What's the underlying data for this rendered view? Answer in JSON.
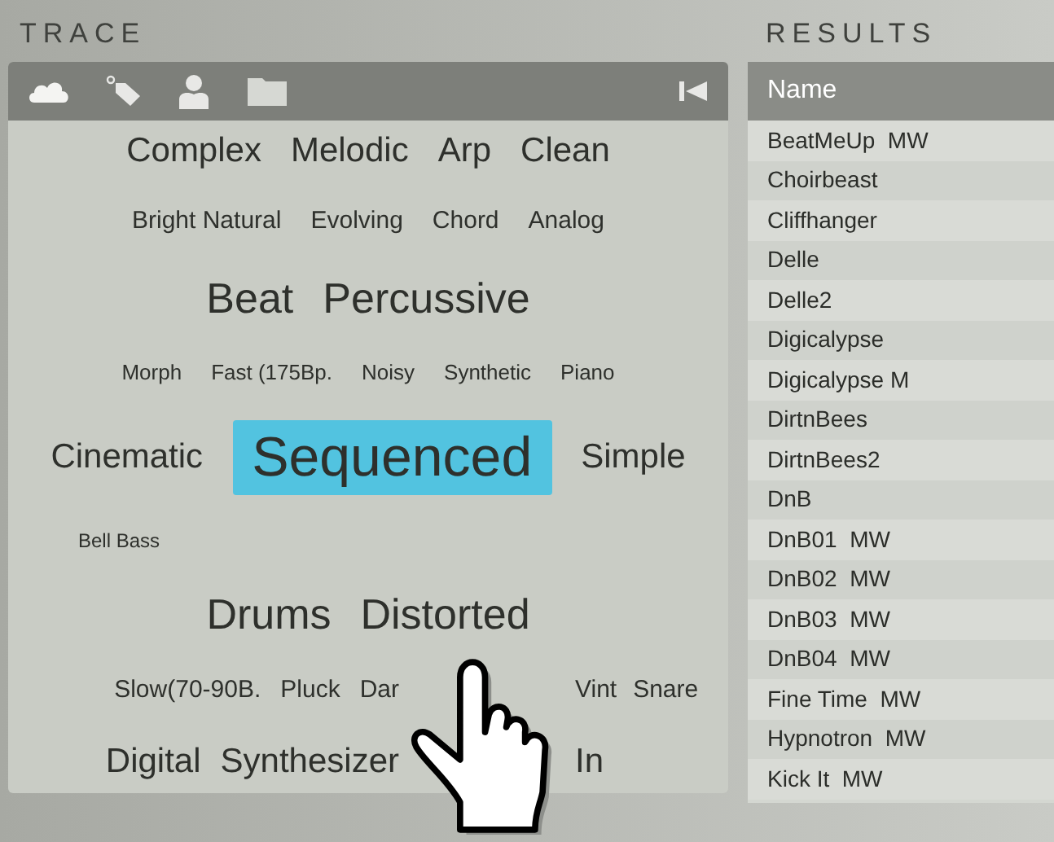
{
  "trace": {
    "title": "TRACE",
    "tag_rows": [
      {
        "tags": [
          {
            "label": "Complex",
            "kind": "large",
            "selected": false
          },
          {
            "label": "Melodic",
            "kind": "large",
            "selected": false
          },
          {
            "label": "Arp",
            "kind": "large",
            "selected": false
          },
          {
            "label": "Clean",
            "kind": "large",
            "selected": false
          }
        ]
      },
      {
        "tags": [
          {
            "label": "Bright Natural",
            "kind": "medium",
            "selected": false
          },
          {
            "label": "Evolving",
            "kind": "medium",
            "selected": false
          },
          {
            "label": "Chord",
            "kind": "medium",
            "selected": false
          },
          {
            "label": "Analog",
            "kind": "medium",
            "selected": false
          }
        ]
      },
      {
        "tags": [
          {
            "label": "Beat",
            "kind": "xlarge",
            "selected": false
          },
          {
            "label": "Percussive",
            "kind": "xlarge",
            "selected": false
          }
        ]
      },
      {
        "tags": [
          {
            "label": "Morph",
            "kind": "small",
            "selected": false
          },
          {
            "label": "Fast (175Bp.",
            "kind": "small",
            "selected": false
          },
          {
            "label": "Noisy",
            "kind": "small",
            "selected": false
          },
          {
            "label": "Synthetic",
            "kind": "small",
            "selected": false
          },
          {
            "label": "Piano",
            "kind": "small",
            "selected": false
          }
        ]
      },
      {
        "tags": [
          {
            "label": "Cinematic",
            "kind": "large",
            "selected": false
          },
          {
            "label": "Sequenced",
            "kind": "huge",
            "selected": true
          },
          {
            "label": "Simple",
            "kind": "large",
            "selected": false
          }
        ]
      },
      {
        "tags": [
          {
            "label": "Bell Bass",
            "kind": "tiny",
            "selected": false
          }
        ]
      },
      {
        "tags": [
          {
            "label": "Drums",
            "kind": "xlarge",
            "selected": false
          },
          {
            "label": "Distorted",
            "kind": "xlarge",
            "selected": false
          }
        ]
      },
      {
        "tags": [
          {
            "label": "Slow(70-90B.",
            "kind": "medium",
            "selected": false
          },
          {
            "label": "Pluck",
            "kind": "medium",
            "selected": false
          },
          {
            "label": "Dar",
            "kind": "medium",
            "selected": false
          },
          {
            "label": "Vint",
            "kind": "medium",
            "selected": false
          },
          {
            "label": "Snare",
            "kind": "medium",
            "selected": false
          }
        ]
      },
      {
        "tags": [
          {
            "label": "Digital",
            "kind": "large",
            "selected": false
          },
          {
            "label": "Synthesizer",
            "kind": "large",
            "selected": false
          },
          {
            "label": "In",
            "kind": "large",
            "selected": false
          }
        ]
      }
    ]
  },
  "results": {
    "title": "RESULTS",
    "column": "Name",
    "rows": [
      "BeatMeUp  MW",
      "Choirbeast",
      "Cliffhanger",
      "Delle",
      "Delle2",
      "Digicalypse",
      "Digicalypse M",
      "DirtnBees",
      "DirtnBees2",
      "DnB",
      "DnB01  MW",
      "DnB02  MW",
      "DnB03  MW",
      "DnB04  MW",
      "Fine Time  MW",
      "Hypnotron  MW",
      "Kick It  MW"
    ]
  }
}
